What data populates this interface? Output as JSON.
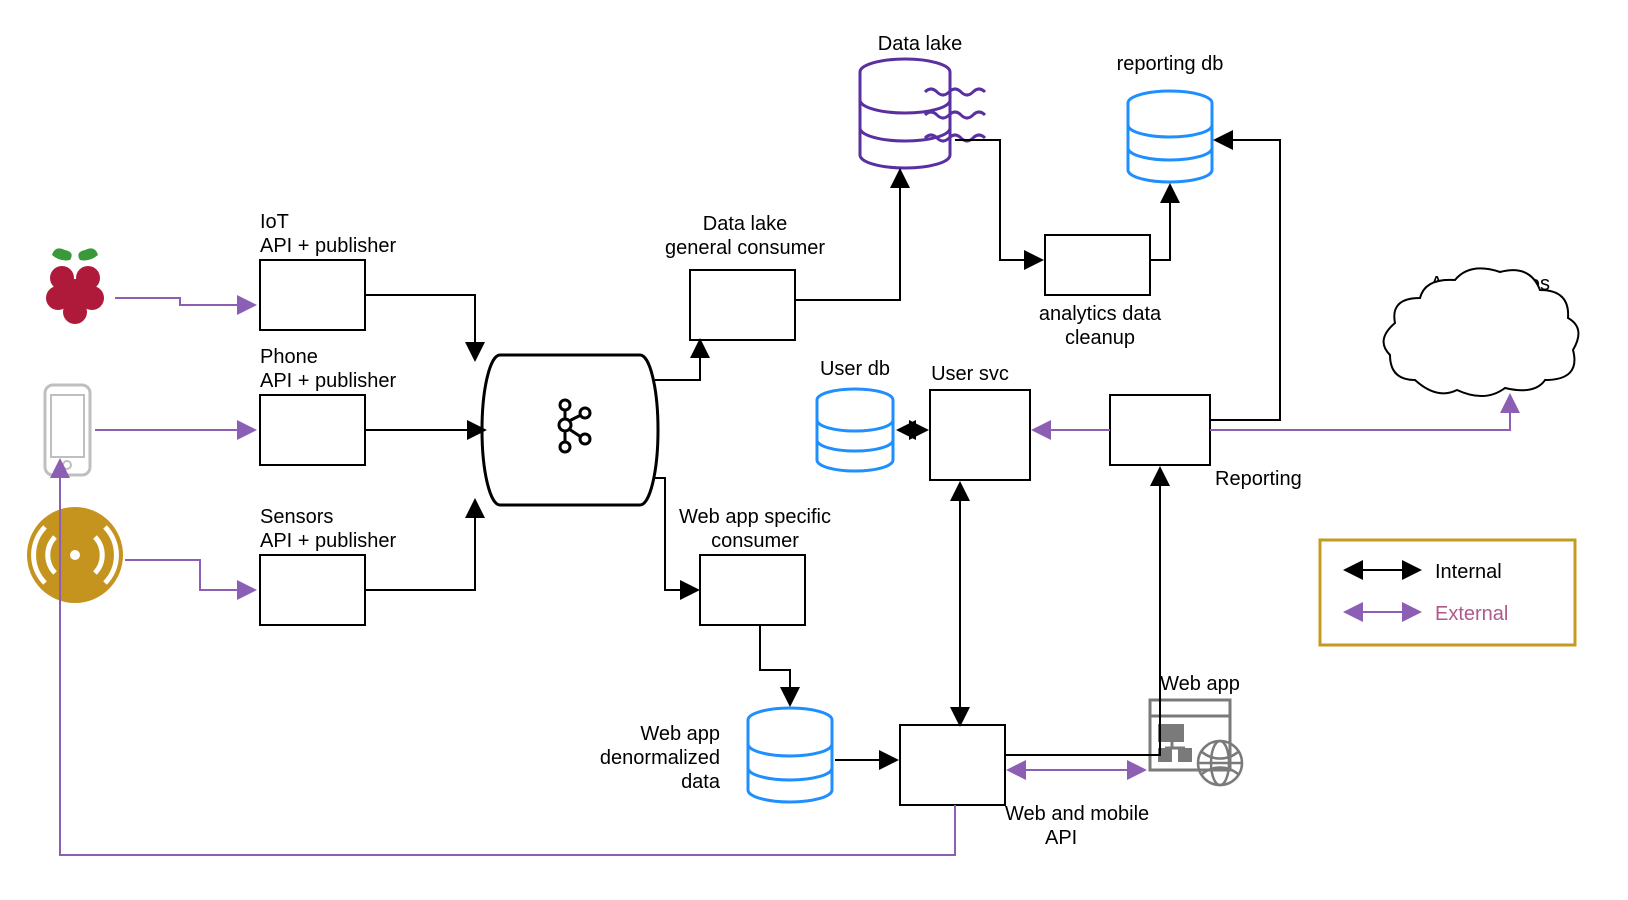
{
  "nodes": {
    "iot": {
      "line1": "IoT",
      "line2": "API + publisher"
    },
    "phone": {
      "line1": "Phone",
      "line2": "API + publisher"
    },
    "sensors": {
      "line1": "Sensors",
      "line2": "API + publisher"
    },
    "dlconsumer": {
      "line1": "Data lake",
      "line2": "general consumer"
    },
    "waconsumer": {
      "line1": "Web app specific",
      "line2": "consumer"
    },
    "datalake": "Data lake",
    "reportingdb": "reporting db",
    "analytics": {
      "line1": "analytics data",
      "line2": "cleanup"
    },
    "userdb": "User db",
    "usersvc": "User svc",
    "reporting": "Reporting",
    "auth": "Auth services",
    "wadenorm": {
      "line1": "Web app",
      "line2": "denormalized",
      "line3": "data"
    },
    "webapi": {
      "line1": "Web and mobile",
      "line2": "API"
    },
    "webapp": "Web app"
  },
  "legend": {
    "internal": "Internal",
    "external": "External"
  }
}
